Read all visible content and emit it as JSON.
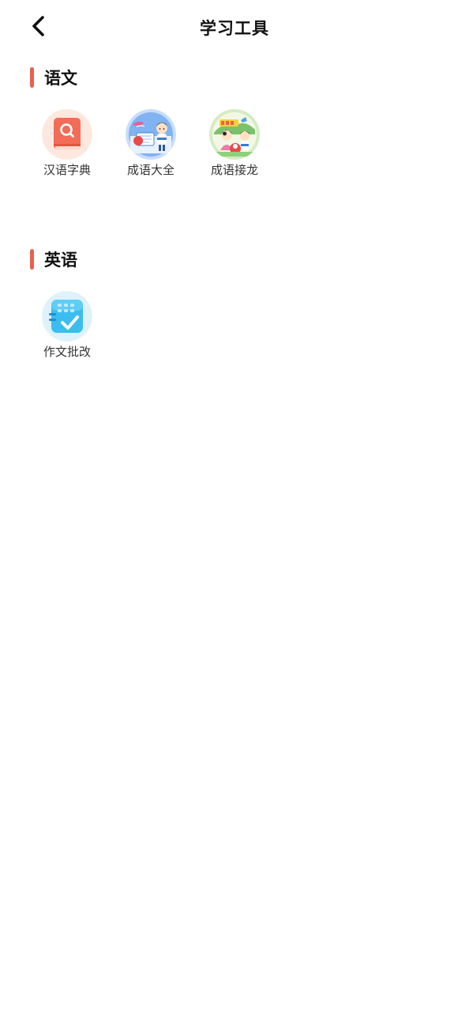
{
  "header": {
    "title": "学习工具",
    "back_icon": "chevron-left-icon"
  },
  "colors": {
    "accent": "#e8604f",
    "background": "#ffffff",
    "text": "#111111"
  },
  "sections": [
    {
      "title": "语文",
      "tools": [
        {
          "label": "汉语字典",
          "icon": "dictionary-book-search-icon"
        },
        {
          "label": "成语大全",
          "icon": "idiom-collection-icon"
        },
        {
          "label": "成语接龙",
          "icon": "idiom-chain-icon"
        }
      ]
    },
    {
      "title": "英语",
      "tools": [
        {
          "label": "作文批改",
          "icon": "essay-correction-check-icon"
        }
      ]
    }
  ]
}
